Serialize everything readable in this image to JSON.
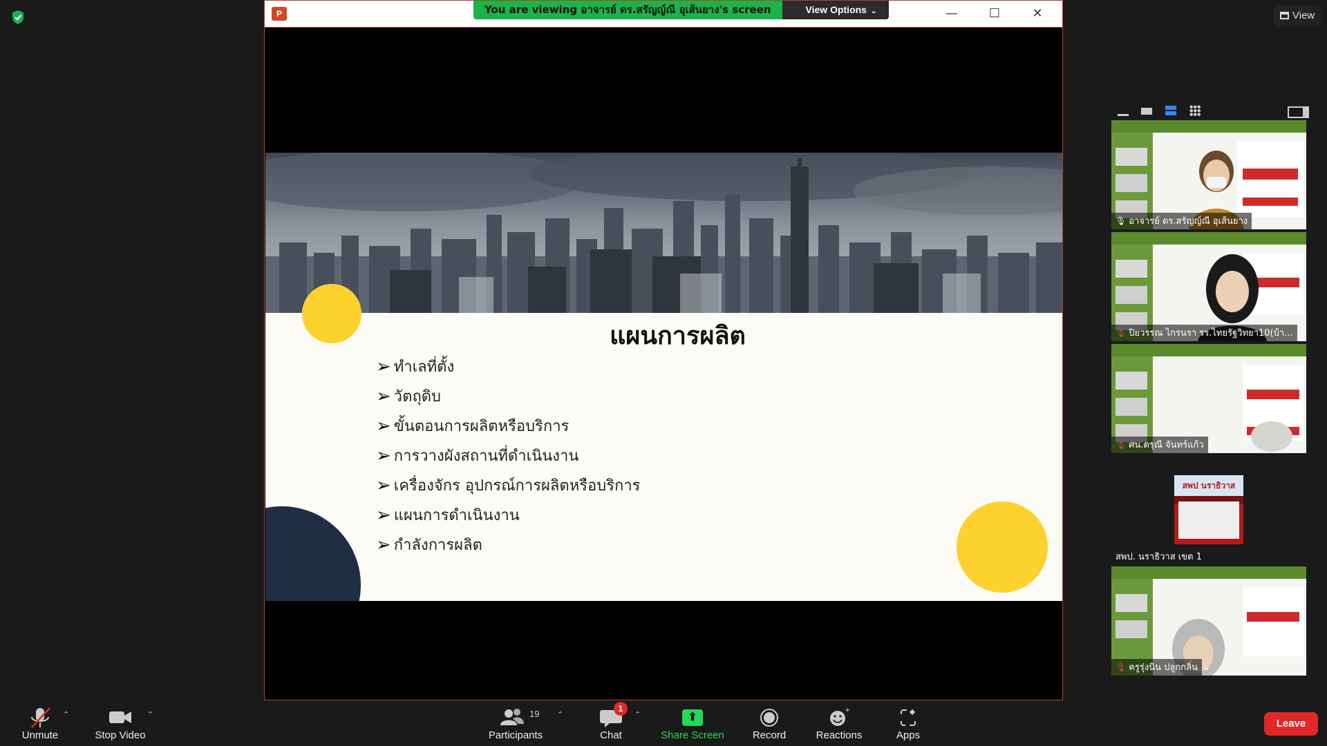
{
  "banner": {
    "viewing_text": "You are viewing อาจารย์ ดร.สรัญญ์ณี อุเส้นยาง's screen",
    "view_options_label": "View Options"
  },
  "window": {
    "app_icon_label": "P"
  },
  "slide": {
    "title": "แผนการผลิต",
    "bullets": [
      "ทำเลที่ตั้ง",
      "วัตถุดิบ",
      "ขั้นตอนการผลิตหรือบริการ",
      "การวางผังสถานที่ดำเนินงาน",
      "เครื่องจักร อุปกรณ์การผลิตหรือบริการ",
      "แผนการดำเนินงาน",
      "กำลังการผลิต"
    ],
    "colors": {
      "yellow": "#fdd12e",
      "navy": "#1f2d45"
    }
  },
  "right_panel": {
    "view_label": "View",
    "tiles": [
      {
        "name": "อาจารย์ ดร.สรัญญ์ณี อุเส้นยาง",
        "muted": false
      },
      {
        "name": "ปิยวรรณ ไกรนรา รร.ไทยรัฐวิทยา10(บ้า...",
        "muted": true
      },
      {
        "name": "ศน.ดรุณี จันทร์แก้ว",
        "muted": true
      },
      {
        "name": "สพป. นราธิวาส เขต 1",
        "muted": false,
        "logo_text": "สพป นราธิวาส"
      },
      {
        "name": "ครูรุ่งนิน ปลูกกลิ่น",
        "muted": true
      }
    ]
  },
  "toolbar": {
    "unmute_label": "Unmute",
    "stop_video_label": "Stop Video",
    "participants_label": "Participants",
    "participants_count": "19",
    "chat_label": "Chat",
    "chat_badge": "1",
    "share_label": "Share Screen",
    "record_label": "Record",
    "reactions_label": "Reactions",
    "apps_label": "Apps",
    "leave_label": "Leave"
  }
}
